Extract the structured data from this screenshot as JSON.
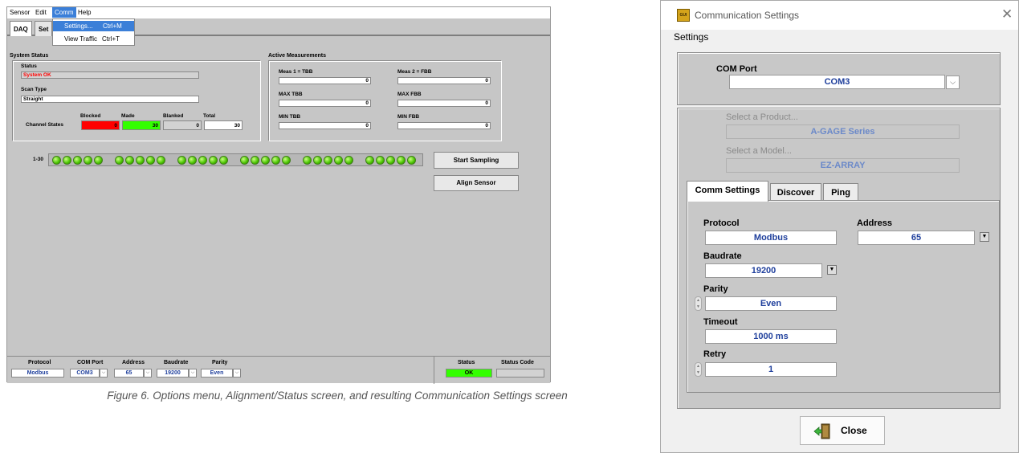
{
  "left_app": {
    "menu": [
      "Sensor",
      "Edit",
      "Comm",
      "Help"
    ],
    "tabs": [
      "DAQ",
      "Set"
    ],
    "comm_menu": [
      {
        "label": "Settings...",
        "shortcut": "Ctrl+M"
      },
      {
        "label": "View Traffic",
        "shortcut": "Ctrl+T"
      }
    ],
    "system_status": {
      "section": "System Status",
      "status_label": "Status",
      "status_value": "System OK",
      "scan_type_label": "Scan Type",
      "scan_type_value": "Straight",
      "channel_states_label": "Channel States",
      "blocked_label": "Blocked",
      "blocked_value": "0",
      "made_label": "Made",
      "made_value": "30",
      "blanked_label": "Blanked",
      "blanked_value": "0",
      "total_label": "Total",
      "total_value": "30",
      "colors": {
        "blocked": "#ff0000",
        "made": "#33ff00",
        "status_text": "#ff0000"
      }
    },
    "active_measurements": {
      "section": "Active Measurements",
      "meas1_label": "Meas 1 = TBB",
      "meas1_value": "0",
      "meas2_label": "Meas 2 = FBB",
      "meas2_value": "0",
      "max_tbb_label": "MAX TBB",
      "max_tbb_value": "0",
      "max_fbb_label": "MAX FBB",
      "max_fbb_value": "0",
      "min_tbb_label": "MIN TBB",
      "min_tbb_value": "0",
      "min_fbb_label": "MIN FBB",
      "min_fbb_value": "0"
    },
    "led_range_label": "1-30",
    "led_count": 30,
    "start_sampling": "Start Sampling",
    "align_sensor": "Align Sensor",
    "bottom": {
      "protocol_label": "Protocol",
      "protocol_value": "Modbus",
      "com_port_label": "COM Port",
      "com_port_value": "COM3",
      "address_label": "Address",
      "address_value": "65",
      "baudrate_label": "Baudrate",
      "baudrate_value": "19200",
      "parity_label": "Parity",
      "parity_value": "Even",
      "status_label": "Status",
      "status_value": "OK",
      "status_code_label": "Status Code",
      "status_code_value": ""
    }
  },
  "caption": "Figure 6. Options menu, Alignment/Status screen, and resulting Communication Settings screen",
  "dialog": {
    "title": "Communication Settings",
    "menu": "Settings",
    "com_port_label": "COM Port",
    "com_port_value": "COM3",
    "product_label": "Select a Product...",
    "product_value": "A-GAGE Series",
    "model_label": "Select a Model...",
    "model_value": "EZ-ARRAY",
    "tabs": [
      "Comm Settings",
      "Discover",
      "Ping"
    ],
    "protocol_label": "Protocol",
    "protocol_value": "Modbus",
    "address_label": "Address",
    "address_value": "65",
    "baudrate_label": "Baudrate",
    "baudrate_value": "19200",
    "parity_label": "Parity",
    "parity_value": "Even",
    "timeout_label": "Timeout",
    "timeout_value": "1000 ms",
    "retry_label": "Retry",
    "retry_value": "1",
    "close_label": "Close",
    "icon_text": "GUI"
  }
}
